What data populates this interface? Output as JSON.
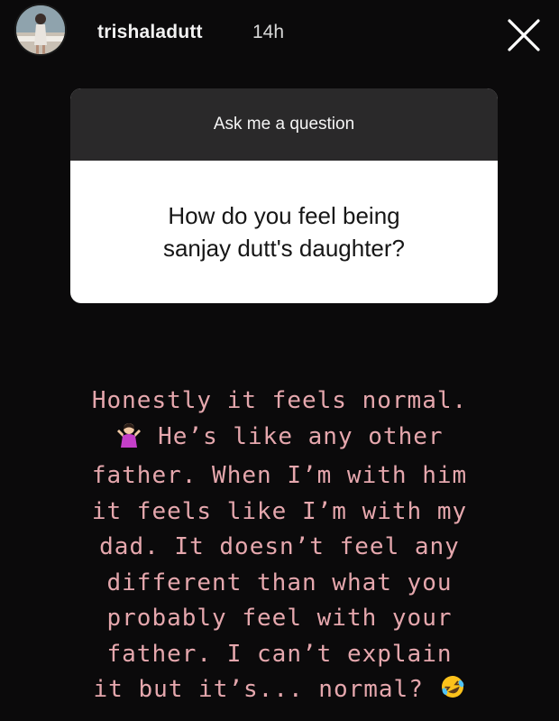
{
  "story": {
    "username": "trishaladutt",
    "time": "14h"
  },
  "question_sticker": {
    "title": "Ask me a question",
    "question_lines": [
      "How do you feel being",
      "sanjay dutt's daughter?"
    ]
  },
  "answer": {
    "line1": "Honestly it feels normal.",
    "line2": "He’s like any other",
    "line3": "father. When I’m with him",
    "line4": "it feels like I’m with my",
    "line5": "dad. It doesn’t feel any",
    "line6": "different than what you",
    "line7": "probably feel with your",
    "line8": "father. I can’t explain",
    "line9": "it but it’s... normal?"
  },
  "icons": {
    "close": "close-icon",
    "shrug": "person-shrugging-emoji",
    "laugh": "rolling-on-floor-laughing-emoji"
  },
  "colors": {
    "background": "#0b0a0b",
    "answer_text": "#e5a7ad",
    "sticker_header": "#2a292a"
  }
}
